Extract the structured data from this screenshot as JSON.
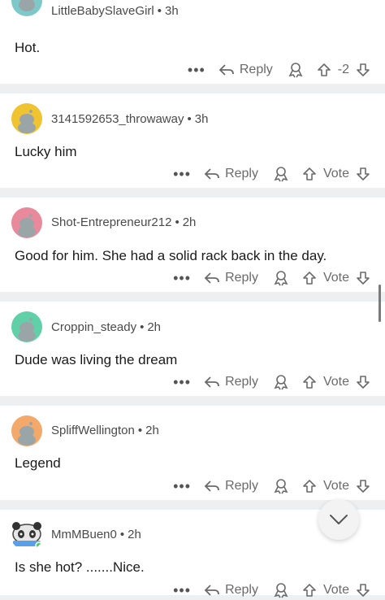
{
  "comments": [
    {
      "user": "LittleBabySlaveGirl",
      "time": "3h",
      "text": "Hot.",
      "vote": "-2",
      "reply": "Reply",
      "avatar_color": "#7ec8c9"
    },
    {
      "user": "3141592653_throwaway",
      "time": "3h",
      "text": "Lucky him",
      "vote": "Vote",
      "reply": "Reply",
      "avatar_color": "#f0c330"
    },
    {
      "user": "Shot-Entrepreneur212",
      "time": "2h",
      "text": "Good for him. She had a solid rack back in the day.",
      "vote": "Vote",
      "reply": "Reply",
      "avatar_color": "#e88a9c"
    },
    {
      "user": "Croppin_steady",
      "time": "2h",
      "text": "Dude was living the dream",
      "vote": "Vote",
      "reply": "Reply",
      "avatar_color": "#5fd0a8"
    },
    {
      "user": "SpliffWellington",
      "time": "2h",
      "text": "Legend",
      "vote": "Vote",
      "reply": "Reply",
      "avatar_color": "#f2a96a"
    },
    {
      "user": "MmMBuen0",
      "time": "2h",
      "text": "Is she hot? .......Nice.",
      "vote": "Vote",
      "reply": "Reply",
      "avatar_color": "#ffffff"
    }
  ],
  "more_glyph": "•••",
  "separator": "•",
  "icons": {
    "reply": "reply-arrow-icon",
    "award": "award-icon",
    "upvote": "upvote-arrow-icon",
    "downvote": "downvote-arrow-icon",
    "scroll_down": "chevron-down-icon"
  }
}
